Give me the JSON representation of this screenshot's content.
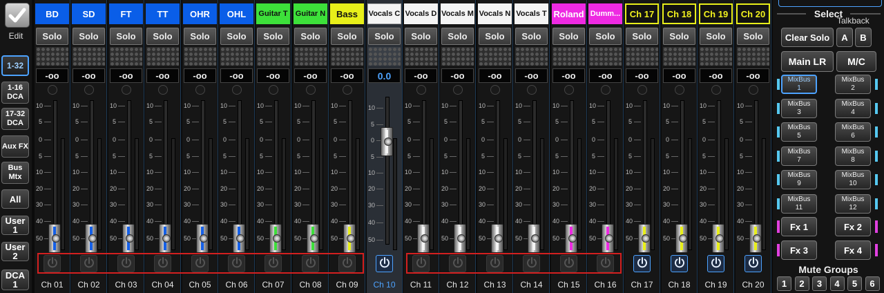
{
  "nav": {
    "edit_label": "Edit",
    "buttons": [
      {
        "label": "1-32",
        "active": true
      },
      {
        "label": "1-16 DCA"
      },
      {
        "label": "17-32 DCA"
      },
      {
        "label": "Aux FX"
      },
      {
        "label": "Bus Mtx"
      },
      {
        "label": "All"
      },
      {
        "label": "User 1"
      },
      {
        "label": "User 2"
      },
      {
        "label": "DCA 1"
      }
    ]
  },
  "solo_label": "Solo",
  "scale_labels": [
    "10",
    "5",
    "0",
    "5",
    "10",
    "20",
    "30",
    "40",
    "50"
  ],
  "channels": [
    {
      "name": "BD",
      "label": "Ch 01",
      "color": "#0a5ee8",
      "text": "#ffffff",
      "gain": "-oo",
      "fader": "#1560e8",
      "power": false
    },
    {
      "name": "SD",
      "label": "Ch 02",
      "color": "#0a5ee8",
      "text": "#ffffff",
      "gain": "-oo",
      "fader": "#1560e8",
      "power": false
    },
    {
      "name": "FT",
      "label": "Ch 03",
      "color": "#0a5ee8",
      "text": "#ffffff",
      "gain": "-oo",
      "fader": "#1560e8",
      "power": false
    },
    {
      "name": "TT",
      "label": "Ch 04",
      "color": "#0a5ee8",
      "text": "#ffffff",
      "gain": "-oo",
      "fader": "#1560e8",
      "power": false
    },
    {
      "name": "OHR",
      "label": "Ch 05",
      "color": "#0a5ee8",
      "text": "#ffffff",
      "gain": "-oo",
      "fader": "#1560e8",
      "power": false
    },
    {
      "name": "OHL",
      "label": "Ch 06",
      "color": "#0a5ee8",
      "text": "#ffffff",
      "gain": "-oo",
      "fader": "#1560e8",
      "power": false
    },
    {
      "name": "Guitar T",
      "label": "Ch 07",
      "color": "#3de03a",
      "text": "#111111",
      "gain": "-oo",
      "fader": "#3de03a",
      "power": false,
      "small": true
    },
    {
      "name": "Guitar N",
      "label": "Ch 08",
      "color": "#3de03a",
      "text": "#111111",
      "gain": "-oo",
      "fader": "#3de03a",
      "power": false,
      "small": true
    },
    {
      "name": "Bass",
      "label": "Ch 09",
      "color": "#e8ef1a",
      "text": "#111111",
      "gain": "-oo",
      "fader": "#e8ef1a",
      "power": false
    },
    {
      "name": "Vocals C",
      "label": "Ch 10",
      "color": "#f4f4f4",
      "text": "#111111",
      "gain": "0.0",
      "fader": "#f4f4f4",
      "power": true,
      "selected": true,
      "small": true
    },
    {
      "name": "Vocals D",
      "label": "Ch 11",
      "color": "#f4f4f4",
      "text": "#111111",
      "gain": "-oo",
      "fader": "#f4f4f4",
      "power": false,
      "small": true
    },
    {
      "name": "Vocals M",
      "label": "Ch 12",
      "color": "#f4f4f4",
      "text": "#111111",
      "gain": "-oo",
      "fader": "#f4f4f4",
      "power": false,
      "small": true
    },
    {
      "name": "Vocals N",
      "label": "Ch 13",
      "color": "#f4f4f4",
      "text": "#111111",
      "gain": "-oo",
      "fader": "#f4f4f4",
      "power": false,
      "small": true
    },
    {
      "name": "Vocals T",
      "label": "Ch 14",
      "color": "#f4f4f4",
      "text": "#111111",
      "gain": "-oo",
      "fader": "#f4f4f4",
      "power": false,
      "small": true
    },
    {
      "name": "Roland",
      "label": "Ch 15",
      "color": "#ee2ae2",
      "text": "#ffffff",
      "gain": "-oo",
      "fader": "#ee2ae2",
      "power": false
    },
    {
      "name": "Dumm...",
      "label": "Ch 16",
      "color": "#ee2ae2",
      "text": "#ffffff",
      "gain": "-oo",
      "fader": "#ee2ae2",
      "power": false,
      "small": true
    },
    {
      "name": "Ch 17",
      "label": "Ch 17",
      "color": "#111111",
      "text": "#f2f21e",
      "border": "#e8ef1a",
      "gain": "-oo",
      "fader": "#e8ef1a",
      "power": true
    },
    {
      "name": "Ch 18",
      "label": "Ch 18",
      "color": "#111111",
      "text": "#f2f21e",
      "border": "#e8ef1a",
      "gain": "-oo",
      "fader": "#e8ef1a",
      "power": true
    },
    {
      "name": "Ch 19",
      "label": "Ch 19",
      "color": "#111111",
      "text": "#f2f21e",
      "border": "#e8ef1a",
      "gain": "-oo",
      "fader": "#e8ef1a",
      "power": true
    },
    {
      "name": "Ch 20",
      "label": "Ch 20",
      "color": "#111111",
      "text": "#f2f21e",
      "border": "#e8ef1a",
      "gain": "-oo",
      "fader": "#e8ef1a",
      "power": true
    }
  ],
  "right": {
    "select_label": "Select",
    "talkback_label": "Talkback",
    "clear_solo": "Clear Solo",
    "talk_a": "A",
    "talk_b": "B",
    "main_lr": "Main LR",
    "mc": "M/C",
    "mixbuses": [
      {
        "label": "MixBus\n1",
        "active": true
      },
      {
        "label": "MixBus\n2"
      },
      {
        "label": "MixBus\n3"
      },
      {
        "label": "MixBus\n4"
      },
      {
        "label": "MixBus\n5"
      },
      {
        "label": "MixBus\n6"
      },
      {
        "label": "MixBus\n7"
      },
      {
        "label": "MixBus\n8"
      },
      {
        "label": "MixBus\n9"
      },
      {
        "label": "MixBus\n10"
      },
      {
        "label": "MixBus\n11"
      },
      {
        "label": "MixBus\n12"
      }
    ],
    "fx": [
      {
        "label": "Fx 1"
      },
      {
        "label": "Fx 2"
      },
      {
        "label": "Fx 3"
      },
      {
        "label": "Fx 4"
      }
    ],
    "mute_groups_label": "Mute Groups",
    "mute_groups": [
      "1",
      "2",
      "3",
      "4",
      "5",
      "6"
    ]
  },
  "colors": {
    "accent": "#4da3ff",
    "mixbus_edge": "#55c8f0",
    "fx_edge": "#e040e0",
    "highlight": "#d42020"
  }
}
